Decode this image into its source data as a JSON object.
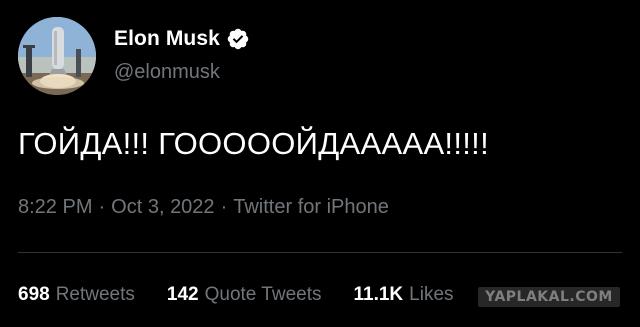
{
  "author": {
    "display_name": "Elon Musk",
    "handle": "@elonmusk",
    "verified_icon": "verified-badge-icon",
    "avatar_icon": "rocket-launch-avatar"
  },
  "tweet": {
    "text": "ГОЙДА!!! ГОООООЙДААААА!!!!!"
  },
  "meta": {
    "time": "8:22 PM",
    "separator1": "·",
    "date": "Oct 3, 2022",
    "separator2": "·",
    "source": "Twitter for iPhone"
  },
  "stats": [
    {
      "count": "698",
      "label": "Retweets"
    },
    {
      "count": "142",
      "label": "Quote Tweets"
    },
    {
      "count": "11.1K",
      "label": "Likes"
    }
  ],
  "watermark": "YAPLAKAL.COM",
  "colors": {
    "background": "#000000",
    "primary_text": "#ffffff",
    "secondary_text": "#71767b",
    "divider": "#2f3336",
    "verified": "#ffffff"
  }
}
